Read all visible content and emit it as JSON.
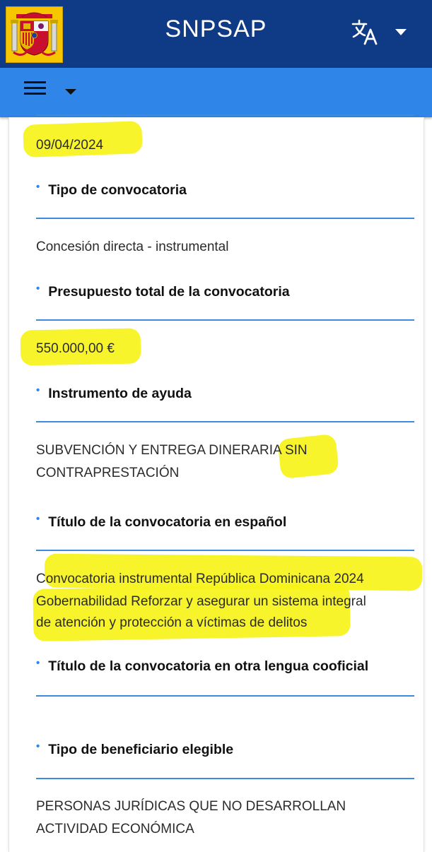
{
  "header": {
    "app_title": "SNPSAP",
    "emblem_icon": "spain-coat-of-arms-icon",
    "translate_icon": "translate-icon",
    "brand_color": "#0e3a86"
  },
  "navbar": {
    "menu_icon": "hamburger-menu-icon",
    "color": "#2f86e8"
  },
  "fields": [
    {
      "label": null,
      "value": "09/04/2024"
    },
    {
      "label": "Tipo de convocatoria",
      "value": "Concesión directa - instrumental"
    },
    {
      "label": "Presupuesto total de la convocatoria",
      "value": "550.000,00 €"
    },
    {
      "label": "Instrumento de ayuda",
      "value_lines": [
        "SUBVENCIÓN Y ENTREGA DINERARIA SIN",
        "CONTRAPRESTACIÓN"
      ]
    },
    {
      "label": "Título de la convocatoria en español",
      "value_lines": [
        "Convocatoria instrumental República Dominicana 2024",
        "Gobernabilidad Reforzar y asegurar un sistema integral",
        "de atención y protección a víctimas de delitos"
      ]
    },
    {
      "label": "Título de la convocatoria en otra lengua cooficial",
      "value": ""
    },
    {
      "label": "Tipo de beneficiario elegible",
      "value_lines": [
        "PERSONAS JURÍDICAS QUE NO DESARROLLAN",
        "ACTIVIDAD ECONÓMICA"
      ]
    }
  ],
  "highlight_color": "#f6f31a"
}
